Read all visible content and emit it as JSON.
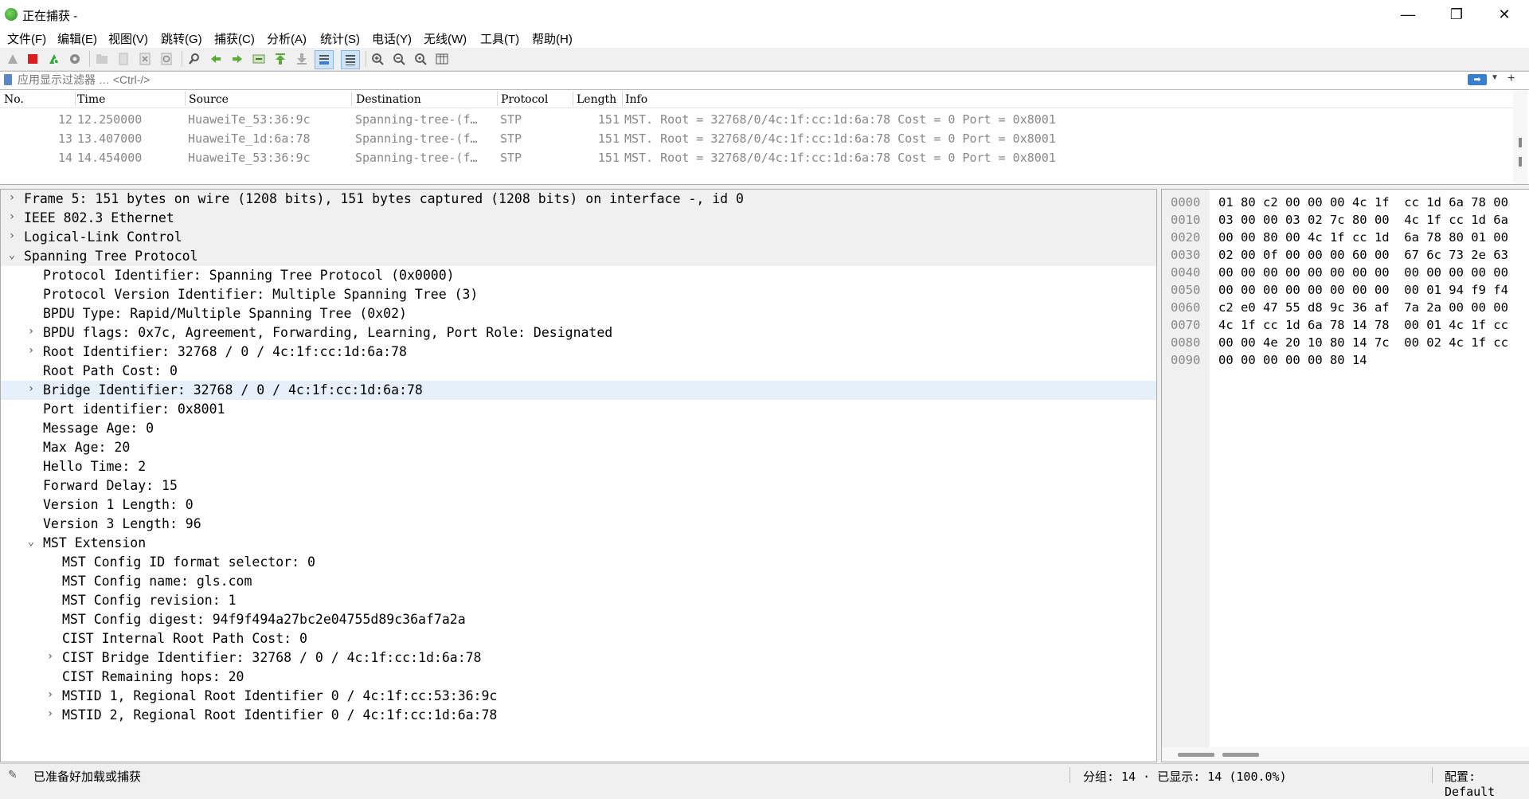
{
  "window": {
    "title": "正在捕获 -",
    "minimize_glyph": "—",
    "maximize_glyph": "❐",
    "close_glyph": "✕"
  },
  "menu": [
    "文件(F)",
    "编辑(E)",
    "视图(V)",
    "跳转(G)",
    "捕获(C)",
    "分析(A)",
    "统计(S)",
    "电话(Y)",
    "无线(W)",
    "工具(T)",
    "帮助(H)"
  ],
  "filter": {
    "placeholder": "应用显示过滤器 … <Ctrl-/>",
    "apply_glyph": "➡",
    "dropdown_glyph": "▼",
    "add_glyph": "+"
  },
  "packet_list": {
    "columns": [
      "No.",
      "Time",
      "Source",
      "Destination",
      "Protocol",
      "Length",
      "Info"
    ],
    "rows": [
      {
        "no": "12",
        "time": "12.250000",
        "source": "HuaweiTe_53:36:9c",
        "destination": "Spanning-tree-(f…",
        "protocol": "STP",
        "length": "151",
        "info": "MST. Root = 32768/0/4c:1f:cc:1d:6a:78  Cost = 0  Port = 0x8001"
      },
      {
        "no": "13",
        "time": "13.407000",
        "source": "HuaweiTe_1d:6a:78",
        "destination": "Spanning-tree-(f…",
        "protocol": "STP",
        "length": "151",
        "info": "MST. Root = 32768/0/4c:1f:cc:1d:6a:78  Cost = 0  Port = 0x8001"
      },
      {
        "no": "14",
        "time": "14.454000",
        "source": "HuaweiTe_53:36:9c",
        "destination": "Spanning-tree-(f…",
        "protocol": "STP",
        "length": "151",
        "info": "MST. Root = 32768/0/4c:1f:cc:1d:6a:78  Cost = 0  Port = 0x8001"
      }
    ]
  },
  "details": {
    "expanded_glyph": "⌄",
    "collapsed_glyph": "›",
    "rows": [
      {
        "text": "Frame 5: 151 bytes on wire (1208 bits), 151 bytes captured (1208 bits) on interface -, id 0",
        "level": 0,
        "expander": "collapsed",
        "style": "section"
      },
      {
        "text": "IEEE 802.3 Ethernet",
        "level": 0,
        "expander": "collapsed",
        "style": "section"
      },
      {
        "text": "Logical-Link Control",
        "level": 0,
        "expander": "collapsed",
        "style": "section"
      },
      {
        "text": "Spanning Tree Protocol",
        "level": 0,
        "expander": "expanded",
        "style": "section"
      },
      {
        "text": "Protocol Identifier: Spanning Tree Protocol (0x0000)",
        "level": 1,
        "expander": "none"
      },
      {
        "text": "Protocol Version Identifier: Multiple Spanning Tree (3)",
        "level": 1,
        "expander": "none"
      },
      {
        "text": "BPDU Type: Rapid/Multiple Spanning Tree (0x02)",
        "level": 1,
        "expander": "none"
      },
      {
        "text": "BPDU flags: 0x7c, Agreement, Forwarding, Learning, Port Role: Designated",
        "level": 1,
        "expander": "collapsed"
      },
      {
        "text": "Root Identifier: 32768 / 0 / 4c:1f:cc:1d:6a:78",
        "level": 1,
        "expander": "collapsed"
      },
      {
        "text": "Root Path Cost: 0",
        "level": 1,
        "expander": "none"
      },
      {
        "text": "Bridge Identifier: 32768 / 0 / 4c:1f:cc:1d:6a:78",
        "level": 1,
        "expander": "collapsed",
        "style": "selected"
      },
      {
        "text": "Port identifier: 0x8001",
        "level": 1,
        "expander": "none"
      },
      {
        "text": "Message Age: 0",
        "level": 1,
        "expander": "none"
      },
      {
        "text": "Max Age: 20",
        "level": 1,
        "expander": "none"
      },
      {
        "text": "Hello Time: 2",
        "level": 1,
        "expander": "none"
      },
      {
        "text": "Forward Delay: 15",
        "level": 1,
        "expander": "none"
      },
      {
        "text": "Version 1 Length: 0",
        "level": 1,
        "expander": "none"
      },
      {
        "text": "Version 3 Length: 96",
        "level": 1,
        "expander": "none"
      },
      {
        "text": "MST Extension",
        "level": 1,
        "expander": "expanded"
      },
      {
        "text": "MST Config ID format selector: 0",
        "level": 2,
        "expander": "none"
      },
      {
        "text": "MST Config name: gls.com",
        "level": 2,
        "expander": "none"
      },
      {
        "text": "MST Config revision: 1",
        "level": 2,
        "expander": "none"
      },
      {
        "text": "MST Config digest: 94f9f494a27bc2e04755d89c36af7a2a",
        "level": 2,
        "expander": "none"
      },
      {
        "text": "CIST Internal Root Path Cost: 0",
        "level": 2,
        "expander": "none"
      },
      {
        "text": "CIST Bridge Identifier: 32768 / 0 / 4c:1f:cc:1d:6a:78",
        "level": 2,
        "expander": "collapsed"
      },
      {
        "text": "CIST Remaining hops: 20",
        "level": 2,
        "expander": "none"
      },
      {
        "text": "MSTID 1, Regional Root Identifier 0 / 4c:1f:cc:53:36:9c",
        "level": 2,
        "expander": "collapsed"
      },
      {
        "text": "MSTID 2, Regional Root Identifier 0 / 4c:1f:cc:1d:6a:78",
        "level": 2,
        "expander": "collapsed"
      }
    ]
  },
  "hex": {
    "rows": [
      {
        "offset": "0000",
        "bytes": "01 80 c2 00 00 00 4c 1f  cc 1d 6a 78 00"
      },
      {
        "offset": "0010",
        "bytes": "03 00 00 03 02 7c 80 00  4c 1f cc 1d 6a"
      },
      {
        "offset": "0020",
        "bytes": "00 00 80 00 4c 1f cc 1d  6a 78 80 01 00"
      },
      {
        "offset": "0030",
        "bytes": "02 00 0f 00 00 00 60 00  67 6c 73 2e 63"
      },
      {
        "offset": "0040",
        "bytes": "00 00 00 00 00 00 00 00  00 00 00 00 00"
      },
      {
        "offset": "0050",
        "bytes": "00 00 00 00 00 00 00 00  00 01 94 f9 f4"
      },
      {
        "offset": "0060",
        "bytes": "c2 e0 47 55 d8 9c 36 af  7a 2a 00 00 00"
      },
      {
        "offset": "0070",
        "bytes": "4c 1f cc 1d 6a 78 14 78  00 01 4c 1f cc"
      },
      {
        "offset": "0080",
        "bytes": "00 00 4e 20 10 80 14 7c  00 02 4c 1f cc"
      },
      {
        "offset": "0090",
        "bytes": "00 00 00 00 00 80 14"
      }
    ]
  },
  "status": {
    "icon_glyph": "✎",
    "message": "已准备好加载或捕获",
    "packets": "分组: 14 · 已显示: 14 (100.0%)",
    "profile": "配置: Default"
  }
}
